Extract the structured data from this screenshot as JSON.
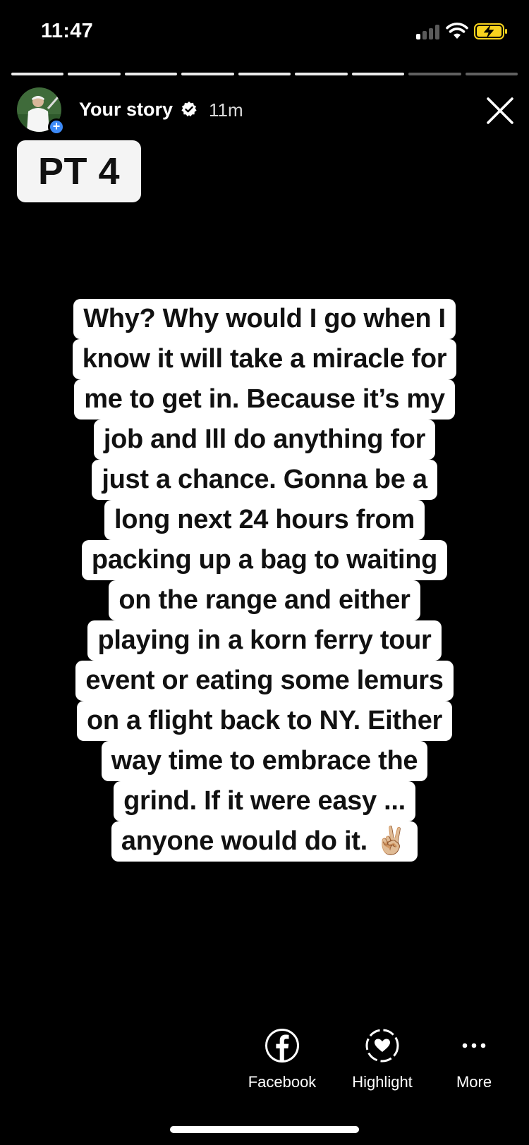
{
  "status_bar": {
    "time": "11:47",
    "icons": [
      "cellular-signal-icon",
      "wifi-icon",
      "battery-charging-icon"
    ],
    "signal_bars_active": 1,
    "signal_bars_total": 4
  },
  "progress": {
    "segments_total": 9,
    "segments_completed": 7
  },
  "story_header": {
    "username": "Your story",
    "verified": true,
    "time_ago": "11m",
    "add_icon": "plus-icon",
    "close_icon": "close-icon"
  },
  "sticker": {
    "label": "PT 4"
  },
  "caption": {
    "lines": [
      "Why? Why would I go when I",
      "know it will take a miracle for",
      "me to get in. Because it’s my",
      "job and Ill do anything for",
      "just a chance. Gonna be a",
      "long next 24 hours from",
      "packing up a bag to waiting",
      "on the range and either",
      "playing in a korn ferry tour",
      "event or eating some lemurs",
      "on a flight back to NY. Either",
      "way time to embrace the",
      "grind. If it were easy ...",
      "anyone would do it. ✌🏼"
    ]
  },
  "actions": {
    "facebook": {
      "label": "Facebook",
      "icon": "facebook-icon"
    },
    "highlight": {
      "label": "Highlight",
      "icon": "highlight-heart-icon"
    },
    "more": {
      "label": "More",
      "icon": "more-dots-icon"
    }
  },
  "colors": {
    "background": "#000000",
    "caption_highlight": "#ffffff",
    "caption_text": "#111111",
    "add_badge": "#3d8af7",
    "battery_charging": "#f7d21e"
  }
}
